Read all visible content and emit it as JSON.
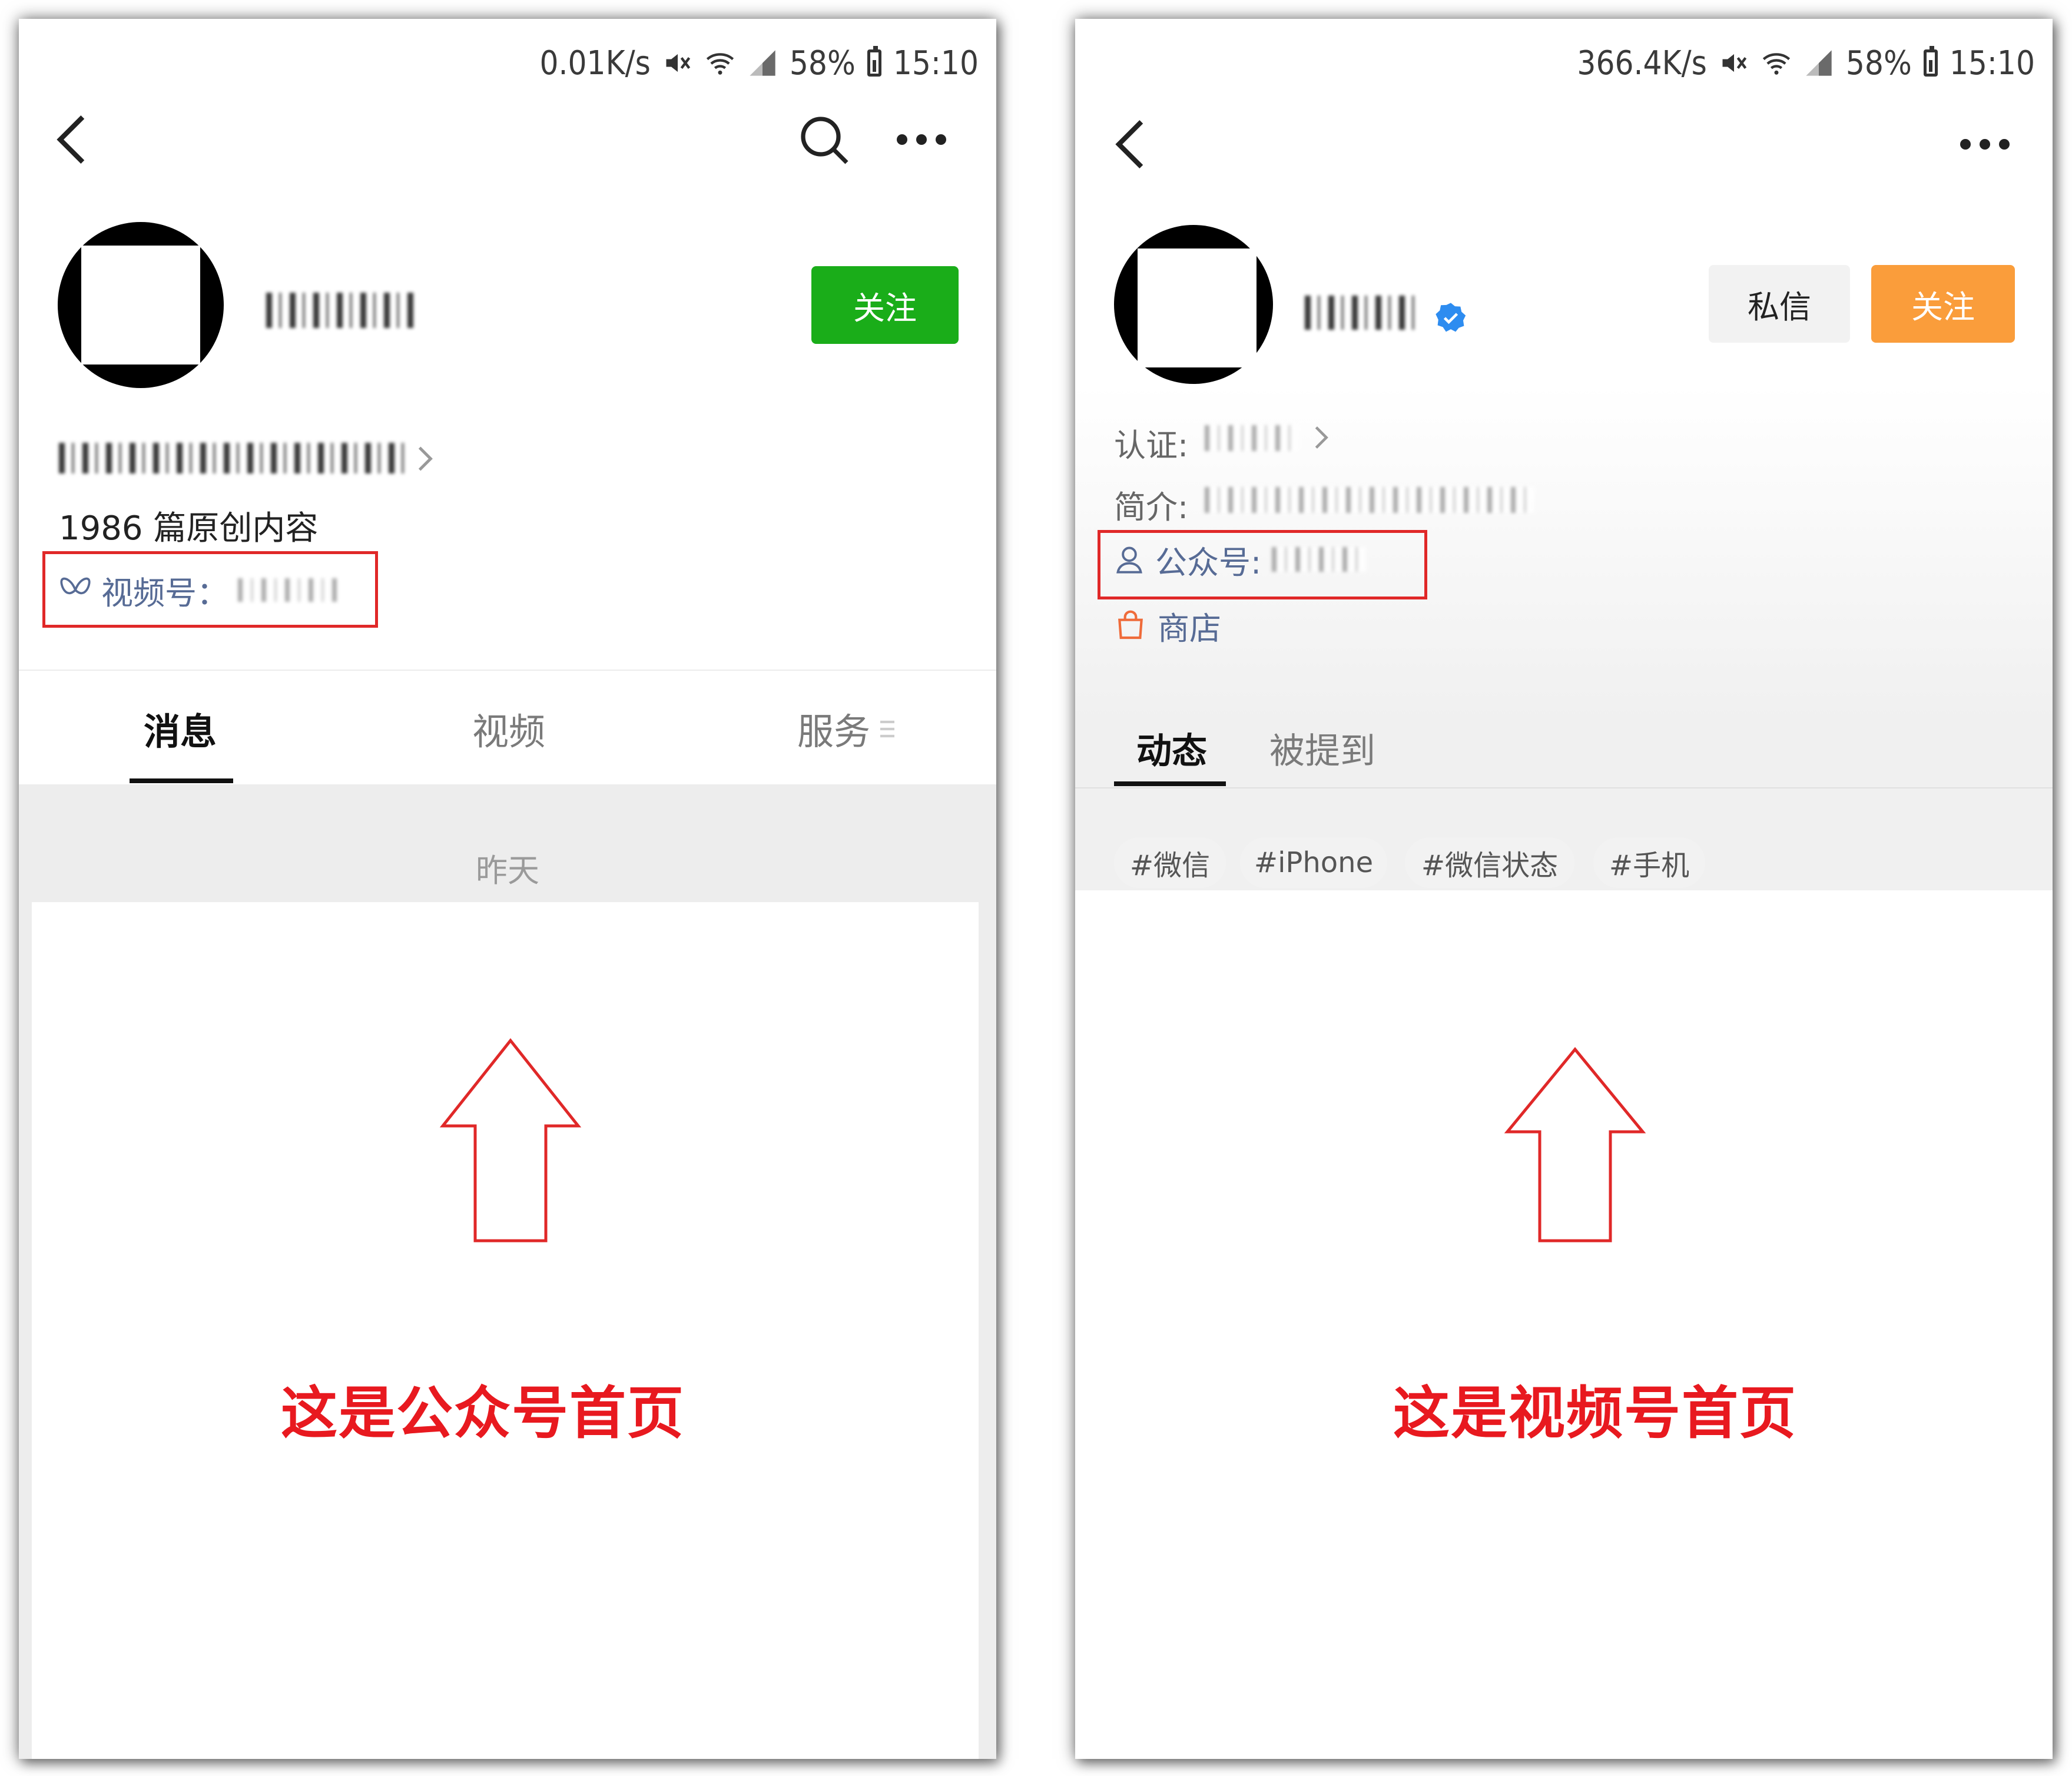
{
  "left": {
    "status": {
      "speed": "0.01K/s",
      "battery": "58%",
      "time": "15:10"
    },
    "follow_label": "关注",
    "article_count": "1986 篇原创内容",
    "channels_link": {
      "label": "视频号："
    },
    "tabs": [
      "消息",
      "视频",
      "服务"
    ],
    "date_label": "昨天",
    "caption": "这是公众号首页",
    "colors": {
      "follow": "#1aad19",
      "highlight": "#e02828",
      "caption": "#e8191f",
      "link": "#576b95"
    }
  },
  "right": {
    "status": {
      "speed": "366.4K/s",
      "battery": "58%",
      "time": "15:10"
    },
    "message_label": "私信",
    "follow_label": "关注",
    "cert_label": "认证:",
    "intro_label": "简介:",
    "official_account_label": "公众号:",
    "shop_label": "商店",
    "tabs": [
      "动态",
      "被提到"
    ],
    "tags": [
      "#微信",
      "#iPhone",
      "#微信状态",
      "#手机"
    ],
    "caption": "这是视频号首页",
    "colors": {
      "follow": "#fa9d3b",
      "verified": "#2d8cf0",
      "link": "#576b95"
    }
  }
}
